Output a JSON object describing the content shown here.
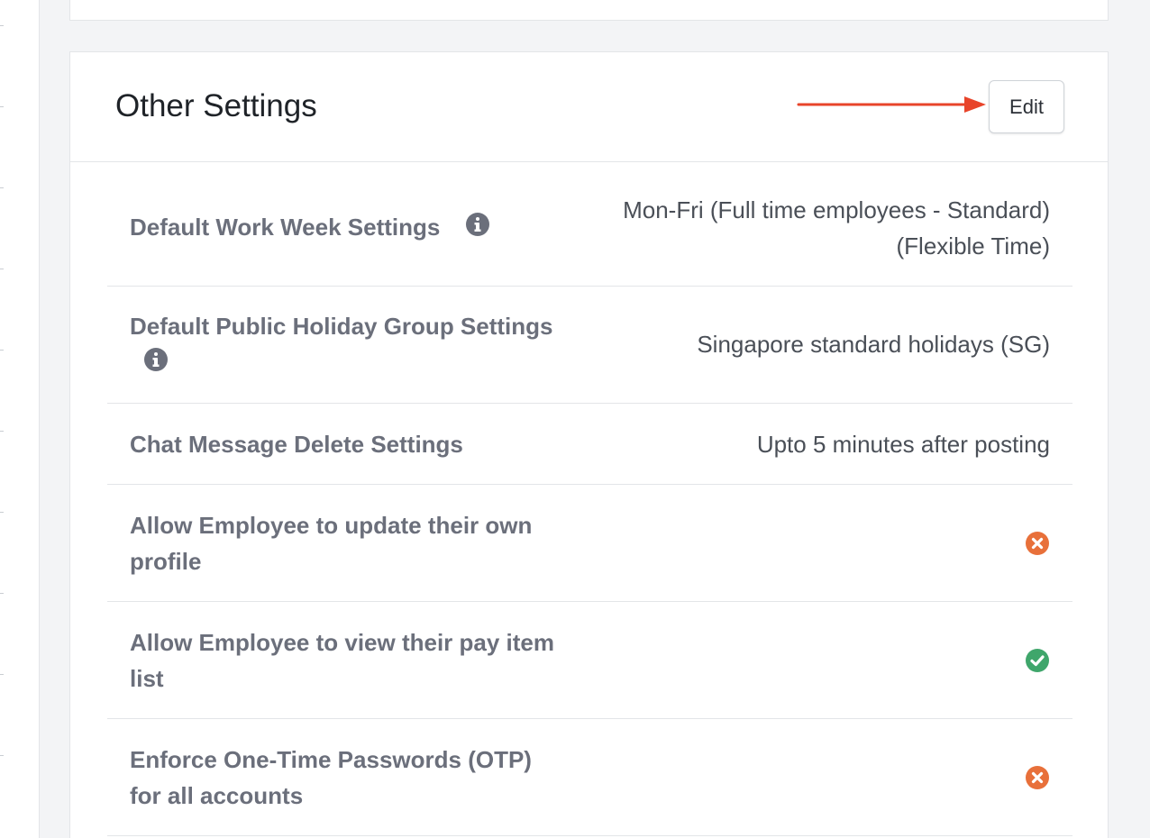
{
  "section": {
    "title": "Other Settings",
    "edit_label": "Edit"
  },
  "colors": {
    "accent_arrow": "#e8442a",
    "disabled": "#e8703a",
    "enabled": "#3fa66b",
    "label": "#6b6f7b"
  },
  "settings": [
    {
      "label": "Default Work Week Settings",
      "has_info": true,
      "value_line1": "Mon-Fri (Full time employees - Standard)",
      "value_line2": "(Flexible Time)"
    },
    {
      "label": "Default Public Holiday Group Settings",
      "has_info": true,
      "value": "Singapore standard holidays (SG)"
    },
    {
      "label": "Chat Message Delete Settings",
      "value": "Upto 5 minutes after posting"
    },
    {
      "label_line1": "Allow Employee to update their own",
      "label_line2": "profile",
      "status": "disabled",
      "status_icon": "x-circle-icon"
    },
    {
      "label_line1": "Allow Employee to view their pay item",
      "label_line2": "list",
      "status": "enabled",
      "status_icon": "check-circle-icon"
    },
    {
      "label_line1": "Enforce One-Time Passwords (OTP)",
      "label_line2": "for all accounts",
      "status": "disabled",
      "status_icon": "x-circle-icon"
    }
  ]
}
